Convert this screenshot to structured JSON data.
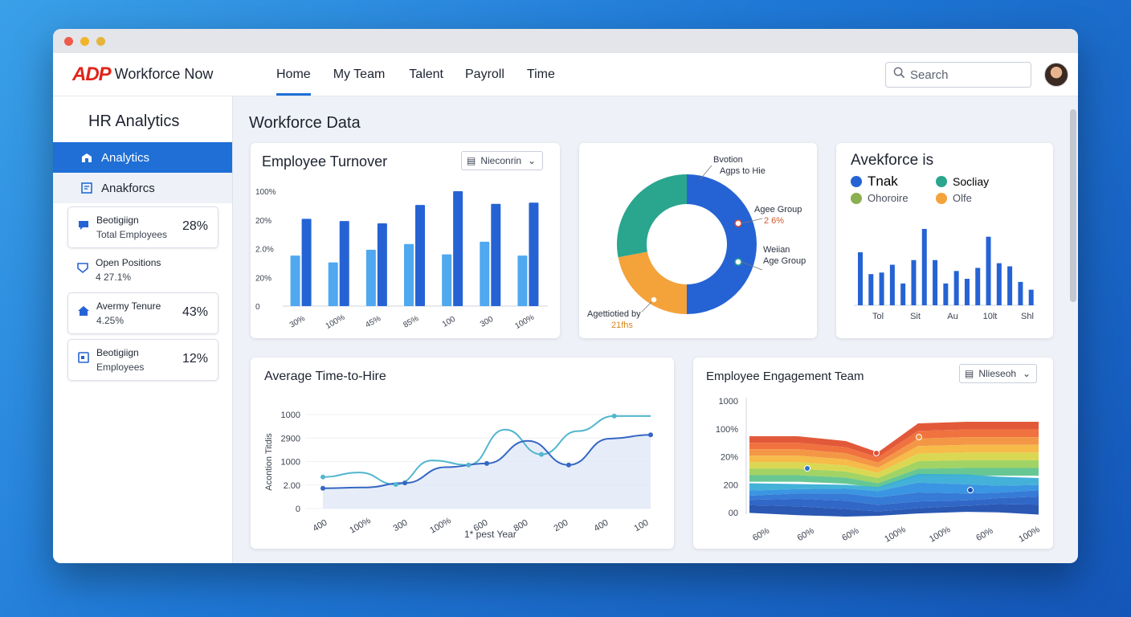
{
  "window": {
    "dots": [
      "#ef5b4a",
      "#f2b429",
      "#5cc44a"
    ]
  },
  "header": {
    "logo": "ADP",
    "product": "Workforce Now",
    "tabs": [
      {
        "label": "Home",
        "active": true
      },
      {
        "label": "My Team",
        "active": false
      },
      {
        "label": "Talent",
        "active": false
      },
      {
        "label": "Payroll",
        "active": false
      },
      {
        "label": "Time",
        "active": false
      }
    ],
    "search_placeholder": "Search"
  },
  "sidebar": {
    "title": "HR Analytics",
    "items": [
      {
        "label": "Analytics",
        "active": true
      },
      {
        "label": "Anakforcs",
        "active": false
      }
    ],
    "cards": [
      {
        "line1": "Beotigiign",
        "line2": "Total Employees",
        "value": "28%"
      },
      {
        "line1": "Open Positions",
        "line2": "4 27.1%",
        "value": ""
      },
      {
        "line1": "Avermy Tenure",
        "line2": "4.25%",
        "value": "43%"
      },
      {
        "line1": "Beotigiign",
        "line2": "Employees",
        "value": "12%"
      }
    ]
  },
  "main": {
    "title": "Workforce Data"
  },
  "colors": {
    "accent": "#1f6fd6",
    "dark_blue": "#2563d4",
    "light_blue": "#4fa8f0",
    "teal": "#2aa58e",
    "orange": "#f4a23a",
    "olive": "#8ab04f"
  },
  "turnover": {
    "title": "Employee Turnover",
    "dropdown": "Nieconrin",
    "chart_data": {
      "type": "bar",
      "categories": [
        "30%",
        "100%",
        "45%",
        "85%",
        "100",
        "300",
        "100%"
      ],
      "series": [
        {
          "values": [
            44,
            38,
            49,
            54,
            45,
            56,
            44
          ]
        },
        {
          "values": [
            76,
            74,
            72,
            88,
            100,
            89,
            90
          ]
        }
      ],
      "ytick_labels": [
        "100%",
        "20%",
        "2.0%",
        "20%",
        "0"
      ],
      "ylim": [
        0,
        100
      ]
    }
  },
  "donut": {
    "labels": [
      {
        "line1": "Bvotion",
        "line2": "Agps to Hie"
      },
      {
        "line1": "Agee Group",
        "line2": "2 6%"
      },
      {
        "line1": "Weiian",
        "line2": "Age Group"
      },
      {
        "line1": "Agettiotied by",
        "line2": "21fhs"
      }
    ],
    "chart_data": {
      "type": "pie",
      "values": [
        50,
        22,
        28
      ],
      "colors": [
        "#2563d4",
        "#f4a23a",
        "#2aa58e"
      ]
    }
  },
  "workforce_panel": {
    "title": "Avekforce is",
    "legend": [
      {
        "label": "Tnak",
        "color": "#2563d4"
      },
      {
        "label": "Socliay",
        "color": "#2aa58e"
      },
      {
        "label": "Ohoroire",
        "color": "#8ab04f"
      },
      {
        "label": "Olfe",
        "color": "#f4a23a"
      }
    ],
    "chart_data": {
      "type": "bar",
      "categories": [
        "Tol",
        "Sit",
        "Au",
        "10lt",
        "Shl"
      ],
      "values": [
        68,
        40,
        42,
        52,
        28,
        58,
        98,
        58,
        28,
        44,
        34,
        48,
        88,
        54,
        50,
        30,
        20
      ]
    }
  },
  "time_to_hire": {
    "title": "Average Time-to-Hire",
    "ylabel": "Acontion Titdis",
    "xlabel": "1* pest Year",
    "chart_data": {
      "type": "area",
      "categories": [
        "400",
        "100%",
        "300",
        "100%",
        "600",
        "800",
        "200",
        "400",
        "100"
      ],
      "ytick_labels": [
        "1000",
        "2900",
        "1000",
        "2.00",
        "0"
      ],
      "series": [
        {
          "values": [
            27,
            28,
            34,
            55,
            60,
            90,
            58,
            93,
            98
          ]
        },
        {
          "values": [
            42,
            48,
            32,
            64,
            58,
            105,
            72,
            103,
            123,
            123
          ]
        }
      ],
      "ylim": [
        0,
        125
      ]
    }
  },
  "engagement": {
    "title": "Employee Engagement Team",
    "dropdown": "Nlieseoh",
    "chart_data": {
      "type": "area",
      "categories": [
        "60%",
        "60%",
        "60%",
        "100%",
        "100%",
        "60%",
        "100%"
      ],
      "ytick_labels": [
        "1000",
        "100%",
        "20%",
        "200",
        "00"
      ]
    }
  }
}
